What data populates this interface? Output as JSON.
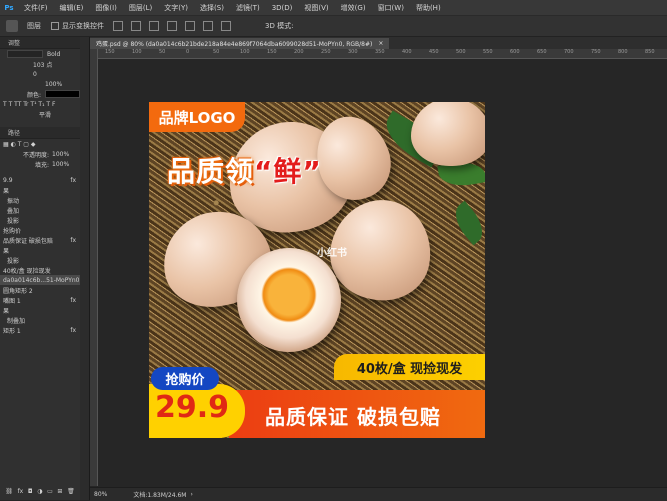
{
  "menubar": {
    "items": [
      "文件(F)",
      "编辑(E)",
      "图像(I)",
      "图层(L)",
      "文字(Y)",
      "选择(S)",
      "滤镜(T)",
      "3D(D)",
      "视图(V)",
      "增效(G)",
      "窗口(W)",
      "帮助(H)"
    ]
  },
  "optionsbar": {
    "layer_select": "图层",
    "show_transform": "显示变换控件",
    "mode_3d": "3D 模式:"
  },
  "document": {
    "tab_title": "鸡蛋.psd @ 80% (da0a014c6b21bde218a84e4e869f7064dba6099028d51-MoPYn0, RGB/8#)"
  },
  "left_panel": {
    "adjust_head": "调整",
    "font_style": "Bold",
    "size_1": "103 点",
    "size_2": "0",
    "scale": "100%",
    "color_label": "颜色:",
    "aa_mode": "平滑",
    "layers_head": "路径",
    "opacity_label": "不透明度:",
    "opacity_value": "100%",
    "fill_label": "填充:",
    "fill_value": "100%",
    "layer_rows": [
      "9.9",
      "果",
      "振动",
      "叠加",
      "投影",
      "抢购价",
      "品质保证  破损包赔",
      "果",
      "投影",
      "40枚/盒  现捡现发",
      "da0a014c6b...51-MoPYn0",
      "圆角矩形 2",
      "嘴图 1",
      "果",
      "制叠加",
      "矩形 1"
    ]
  },
  "rulers": {
    "top_ticks": [
      "150",
      "100",
      "50",
      "0",
      "50",
      "100",
      "150",
      "200",
      "250",
      "300",
      "350",
      "400",
      "450",
      "500",
      "550",
      "600",
      "650",
      "700",
      "750",
      "800",
      "850"
    ]
  },
  "artwork": {
    "logo": "品牌LOGO",
    "headline_prefix": "品质领",
    "headline_highlight": "“鲜”",
    "watermark": "小红书",
    "count": "40枚/盒  现捡现发",
    "price_label": "抢购价",
    "price": "29.9",
    "guarantee": "品质保证  破损包赔",
    "colors": {
      "orange": "#f36a0e",
      "yellow": "#ffd100",
      "blue": "#1447c2",
      "red": "#e02914"
    }
  },
  "statusbar": {
    "zoom": "80%",
    "doc_size": "文档:1.83M/24.6M"
  }
}
